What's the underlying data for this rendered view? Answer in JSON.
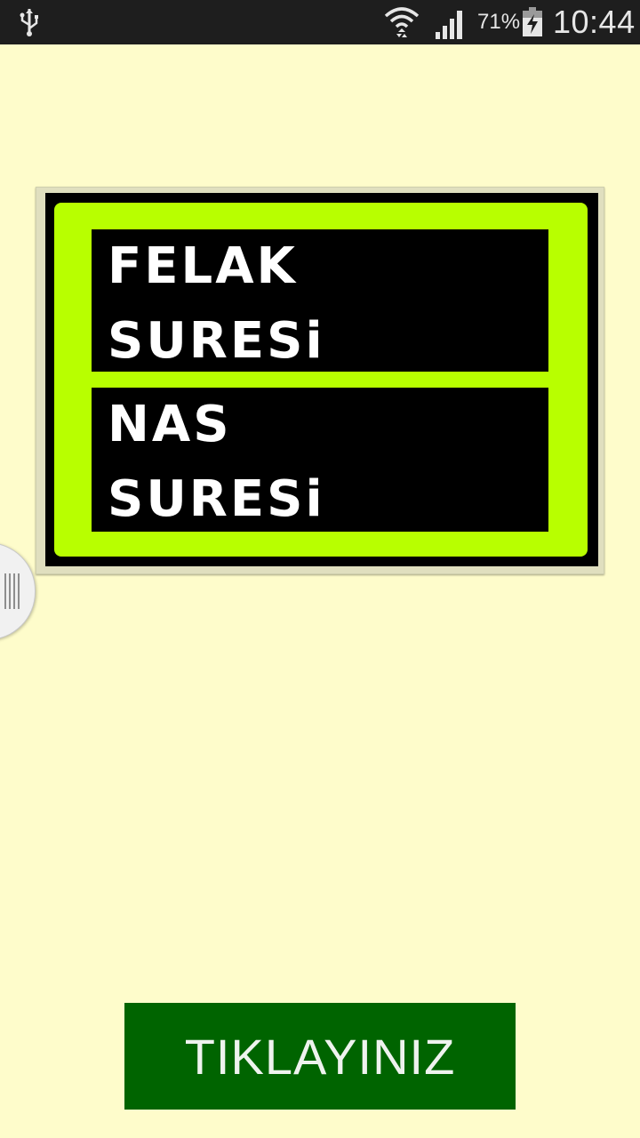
{
  "status_bar": {
    "battery_percent": "71%",
    "time": "10:44",
    "icons": [
      "usb-icon",
      "wifi-icon",
      "signal-icon",
      "battery-charging-icon"
    ]
  },
  "title_image": {
    "box1": {
      "line1": "FELAK",
      "line2": "SURESi"
    },
    "box2": {
      "line1": "NAS",
      "line2": "SURESi"
    },
    "colors": {
      "frame": "#b8ff00",
      "box": "#000000",
      "text": "#ffffff"
    }
  },
  "drawer_handle": {
    "icon": "grip-icon"
  },
  "main_button": {
    "label": "TIKLAYINIZ",
    "color": "#006400"
  },
  "background_color": "#fefccb"
}
